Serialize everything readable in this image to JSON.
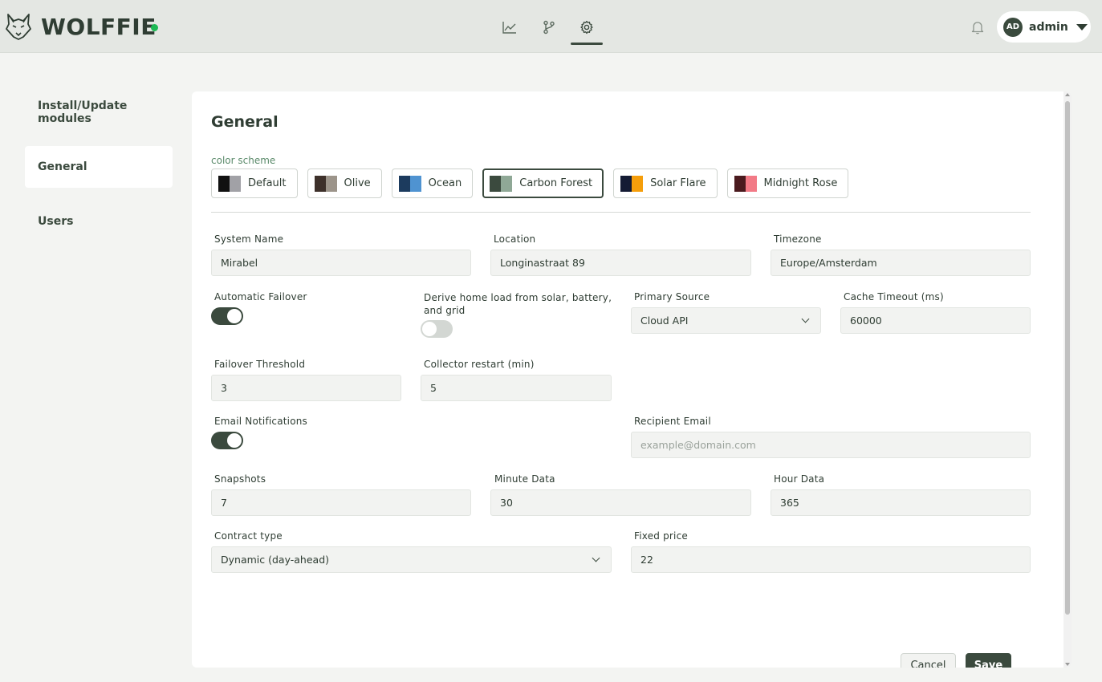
{
  "app": {
    "brand": "WOLFFIE"
  },
  "header": {
    "user": {
      "initials": "AD",
      "name": "admin"
    }
  },
  "sidebar": {
    "items": [
      {
        "label": "Install/Update modules"
      },
      {
        "label": "General"
      },
      {
        "label": "Users"
      }
    ]
  },
  "general": {
    "title": "General",
    "color_scheme_label": "color scheme",
    "schemes": [
      {
        "label": "Default",
        "colors": [
          "#111111",
          "#a1a1a6"
        ]
      },
      {
        "label": "Olive",
        "colors": [
          "#3d302a",
          "#9c948a"
        ]
      },
      {
        "label": "Ocean",
        "colors": [
          "#1c3b5e",
          "#4f93d1"
        ]
      },
      {
        "label": "Carbon Forest",
        "colors": [
          "#3b4a3e",
          "#8fa896"
        ]
      },
      {
        "label": "Solar Flare",
        "colors": [
          "#141b34",
          "#f59e0b"
        ]
      },
      {
        "label": "Midnight Rose",
        "colors": [
          "#4a1a1e",
          "#f27a86"
        ]
      }
    ],
    "fields": {
      "system_name": {
        "label": "System Name",
        "value": "Mirabel"
      },
      "location": {
        "label": "Location",
        "value": "Longinastraat 89"
      },
      "timezone": {
        "label": "Timezone",
        "value": "Europe/Amsterdam"
      },
      "automatic_failover": {
        "label": "Automatic Failover"
      },
      "derive_home_load": {
        "label_line1": "Derive home load from solar, battery,",
        "label_line2": "and grid"
      },
      "primary_source": {
        "label": "Primary Source",
        "value": "Cloud API"
      },
      "cache_timeout": {
        "label": "Cache Timeout (ms)",
        "value": "60000"
      },
      "failover_threshold": {
        "label": "Failover Threshold",
        "value": "3"
      },
      "collector_restart": {
        "label": "Collector restart (min)",
        "value": "5"
      },
      "email_notifications": {
        "label": "Email Notifications"
      },
      "recipient_email": {
        "label": "Recipient Email",
        "placeholder": "example@domain.com"
      },
      "snapshots": {
        "label": "Snapshots",
        "value": "7"
      },
      "minute_data": {
        "label": "Minute Data",
        "value": "30"
      },
      "hour_data": {
        "label": "Hour Data",
        "value": "365"
      },
      "contract_type": {
        "label": "Contract type",
        "value": "Dynamic (day-ahead)"
      },
      "fixed_price": {
        "label": "Fixed price",
        "value": "22"
      }
    },
    "buttons": {
      "cancel": "Cancel",
      "save": "Save"
    }
  },
  "colors": {
    "accent": "#3b4a3e",
    "status_online": "#1db954"
  }
}
